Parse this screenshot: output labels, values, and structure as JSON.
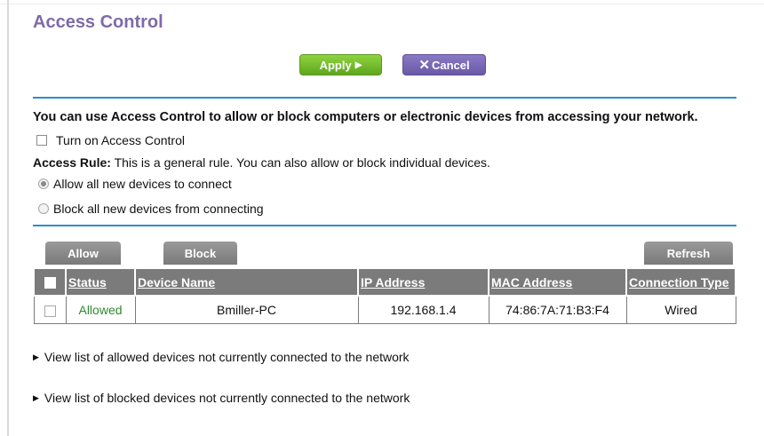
{
  "page": {
    "title": "Access Control"
  },
  "toolbar": {
    "apply_label": "Apply",
    "apply_icon": "▶",
    "cancel_label": "Cancel",
    "cancel_icon": "✕"
  },
  "intro_text": "You can use Access Control to allow or block computers or electronic devices from accessing your network.",
  "turn_on": {
    "label": "Turn on Access Control",
    "checked": false
  },
  "access_rule": {
    "label": "Access Rule:",
    "text": "This is a general rule. You can also allow or block individual devices."
  },
  "rule_options": [
    {
      "label": "Allow all new devices to connect",
      "selected": true
    },
    {
      "label": "Block all new devices from connecting",
      "selected": false
    }
  ],
  "table_buttons": {
    "allow": "Allow",
    "block": "Block",
    "refresh": "Refresh"
  },
  "devices_table": {
    "headers": [
      "Status",
      "Device Name",
      "IP Address",
      "MAC Address",
      "Connection Type"
    ],
    "rows": [
      {
        "status": "Allowed",
        "device_name": "Bmiller-PC",
        "ip": "192.168.1.4",
        "mac": "74:86:7A:71:B3:F4",
        "connection": "Wired"
      }
    ]
  },
  "links": {
    "allowed_not_connected": "View list of allowed devices not currently connected to the network",
    "blocked_not_connected": "View list of blocked devices not currently connected to the network",
    "expander_icon": "▶"
  },
  "colors": {
    "title": "#7e6ba8",
    "apply": "#6fb92c",
    "cancel": "#7a69b6",
    "rule": "#2a8fc9",
    "status_allowed": "#2f8a2f",
    "header_bg": "#7b7b7b"
  }
}
